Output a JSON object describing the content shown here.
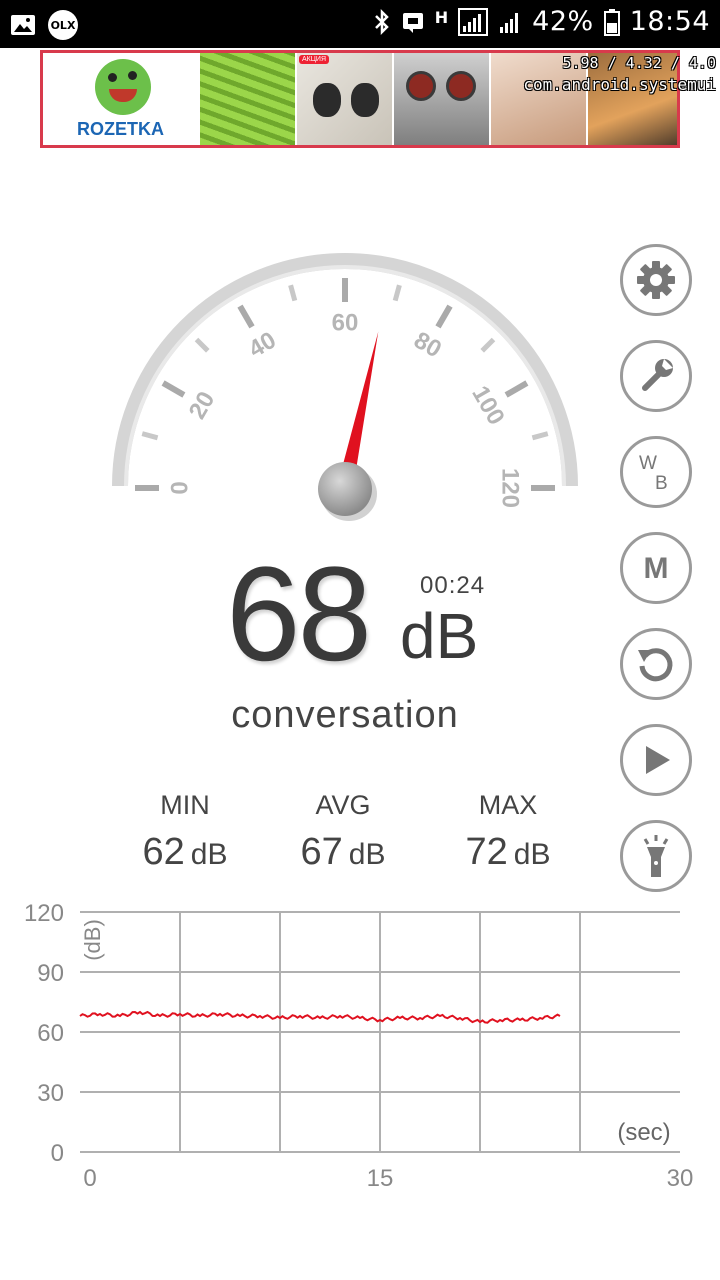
{
  "status_bar": {
    "battery": "42%",
    "time": "18:54",
    "network_label": "H",
    "icons": [
      "image-icon",
      "olx-icon",
      "bluetooth-icon",
      "cast-icon",
      "network-h-icon",
      "signal-icon",
      "signal-icon",
      "battery-icon"
    ],
    "olx_label": "OLX"
  },
  "ad_banner": {
    "brand": "ROZETKA",
    "badge": "АКЦИЯ",
    "debug_perf": "5.98 / 4.32 / 4.0",
    "debug_package": "com.android.systemui"
  },
  "gauge": {
    "min": 0,
    "max": 120,
    "tick_labels": [
      "0",
      "20",
      "40",
      "60",
      "80",
      "100",
      "120"
    ],
    "needle_value": 68,
    "needle_color": "#e0111f"
  },
  "reading": {
    "value": "68",
    "unit": "dB",
    "timer": "00:24",
    "description": "conversation"
  },
  "stats": [
    {
      "label": "MIN",
      "value": "62",
      "unit": "dB"
    },
    {
      "label": "AVG",
      "value": "67",
      "unit": "dB"
    },
    {
      "label": "MAX",
      "value": "72",
      "unit": "dB"
    }
  ],
  "side_buttons": [
    {
      "name": "settings-button",
      "icon": "gear-icon"
    },
    {
      "name": "calibrate-button",
      "icon": "wrench-icon"
    },
    {
      "name": "weighting-button",
      "icon": "wb-icon",
      "text_w": "W",
      "text_b": "B"
    },
    {
      "name": "mode-button",
      "icon": "m-icon",
      "text": "M"
    },
    {
      "name": "reset-button",
      "icon": "reset-icon"
    },
    {
      "name": "play-button",
      "icon": "play-icon"
    },
    {
      "name": "flashlight-button",
      "icon": "flashlight-icon"
    }
  ],
  "chart_data": {
    "type": "line",
    "ylabel": "(dB)",
    "xlabel": "(sec)",
    "ylim": [
      0,
      120
    ],
    "xlim": [
      0,
      30
    ],
    "y_ticks": [
      "120",
      "90",
      "60",
      "30",
      "0"
    ],
    "x_ticks": [
      "0",
      "15",
      "30"
    ],
    "grid": true,
    "line_color": "#e0111f",
    "series": [
      {
        "x": [
          0,
          1,
          2,
          3,
          4,
          5,
          6,
          7,
          8,
          9,
          10,
          11,
          12,
          13,
          14,
          15,
          16,
          17,
          18,
          19,
          20,
          21,
          22,
          23,
          24
        ],
        "values": [
          68,
          69,
          68,
          70,
          68,
          69,
          68,
          69,
          68,
          68,
          67,
          68,
          67,
          68,
          67,
          66,
          67,
          67,
          68,
          67,
          65,
          66,
          66,
          67,
          68
        ]
      }
    ]
  }
}
